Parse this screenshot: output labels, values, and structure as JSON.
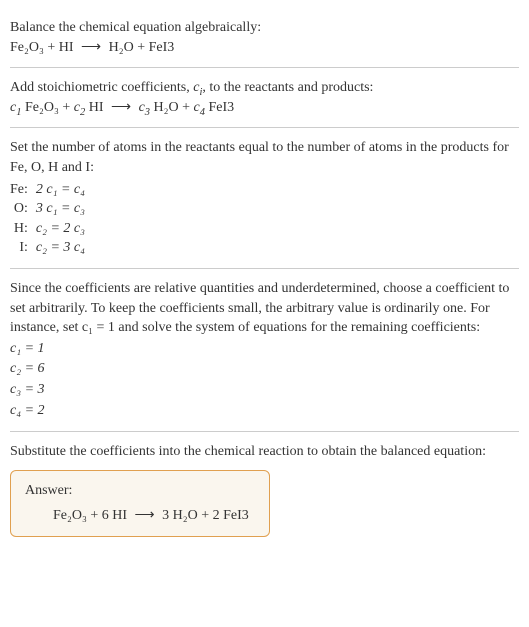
{
  "intro": {
    "line1": "Balance the chemical equation algebraically:",
    "reactants": "Fe₂O₃ + HI",
    "arrow": "⟶",
    "products": "H₂O + FeI3"
  },
  "add_coeffs": {
    "text_before": "Add stoichiometric coefficients, ",
    "ci": "c",
    "ci_sub": "i",
    "text_after": ", to the reactants and products:",
    "eq_c1": "c",
    "eq_c1_sub": "1",
    "eq_r1": " Fe₂O₃ + ",
    "eq_c2": "c",
    "eq_c2_sub": "2",
    "eq_r2": " HI ",
    "arrow": "⟶",
    "eq_c3": " c",
    "eq_c3_sub": "3",
    "eq_r3": " H₂O + ",
    "eq_c4": "c",
    "eq_c4_sub": "4",
    "eq_r4": " FeI3"
  },
  "atoms": {
    "intro": "Set the number of atoms in the reactants equal to the number of atoms in the products for Fe, O, H and I:",
    "rows": [
      {
        "label": "Fe:",
        "eq": "2 c₁ = c₄"
      },
      {
        "label": "O:",
        "eq": "3 c₁ = c₃"
      },
      {
        "label": "H:",
        "eq": "c₂ = 2 c₃"
      },
      {
        "label": "I:",
        "eq": "c₂ = 3 c₄"
      }
    ]
  },
  "solve": {
    "text": "Since the coefficients are relative quantities and underdetermined, choose a coefficient to set arbitrarily. To keep the coefficients small, the arbitrary value is ordinarily one. For instance, set c₁ = 1 and solve the system of equations for the remaining coefficients:",
    "lines": [
      "c₁ = 1",
      "c₂ = 6",
      "c₃ = 3",
      "c₄ = 2"
    ]
  },
  "substitute": {
    "text": "Substitute the coefficients into the chemical reaction to obtain the balanced equation:"
  },
  "answer": {
    "label": "Answer:",
    "lhs": "Fe₂O₃ + 6 HI",
    "arrow": "⟶",
    "rhs": "3 H₂O + 2 FeI3"
  },
  "chart_data": {
    "type": "table",
    "title": "Balancing Fe2O3 + HI -> H2O + FeI3",
    "atom_balance": [
      {
        "element": "Fe",
        "equation": "2 c1 = c4"
      },
      {
        "element": "O",
        "equation": "3 c1 = c3"
      },
      {
        "element": "H",
        "equation": "c2 = 2 c3"
      },
      {
        "element": "I",
        "equation": "c2 = 3 c4"
      }
    ],
    "coefficients": {
      "c1": 1,
      "c2": 6,
      "c3": 3,
      "c4": 2
    },
    "balanced_equation": "Fe2O3 + 6 HI -> 3 H2O + 2 FeI3"
  }
}
